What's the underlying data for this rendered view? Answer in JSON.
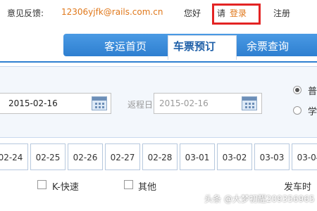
{
  "header": {
    "feedback_label": "意见反馈:",
    "feedback_email": "12306yjfk@rails.com.cn",
    "hello": "您好",
    "please": "请",
    "login": "登录",
    "register": "注册"
  },
  "nav": {
    "tabs": [
      {
        "label": "客运首页",
        "active": false
      },
      {
        "label": "车票预订",
        "active": true
      },
      {
        "label": "余票查询",
        "active": false
      }
    ]
  },
  "search": {
    "depart_date": "2015-02-16",
    "return_label": "返程日",
    "return_date": "2015-02-16",
    "radio_options": [
      {
        "label": "普",
        "selected": true
      },
      {
        "label": "学",
        "selected": false
      }
    ]
  },
  "date_strip": [
    "02-24",
    "02-25",
    "02-26",
    "02-27",
    "02-28",
    "03-01",
    "03-02",
    "03-03",
    "03-04"
  ],
  "filters": {
    "options": [
      {
        "label": "K-快速",
        "checked": false
      },
      {
        "label": "其他",
        "checked": false
      }
    ],
    "depart_time_label": "发车时"
  },
  "watermark": "头条 @大梦初醒209356965",
  "colors": {
    "accent_orange": "#e0781b",
    "nav_blue": "#2e7fd0",
    "highlight_red": "#e32424"
  }
}
